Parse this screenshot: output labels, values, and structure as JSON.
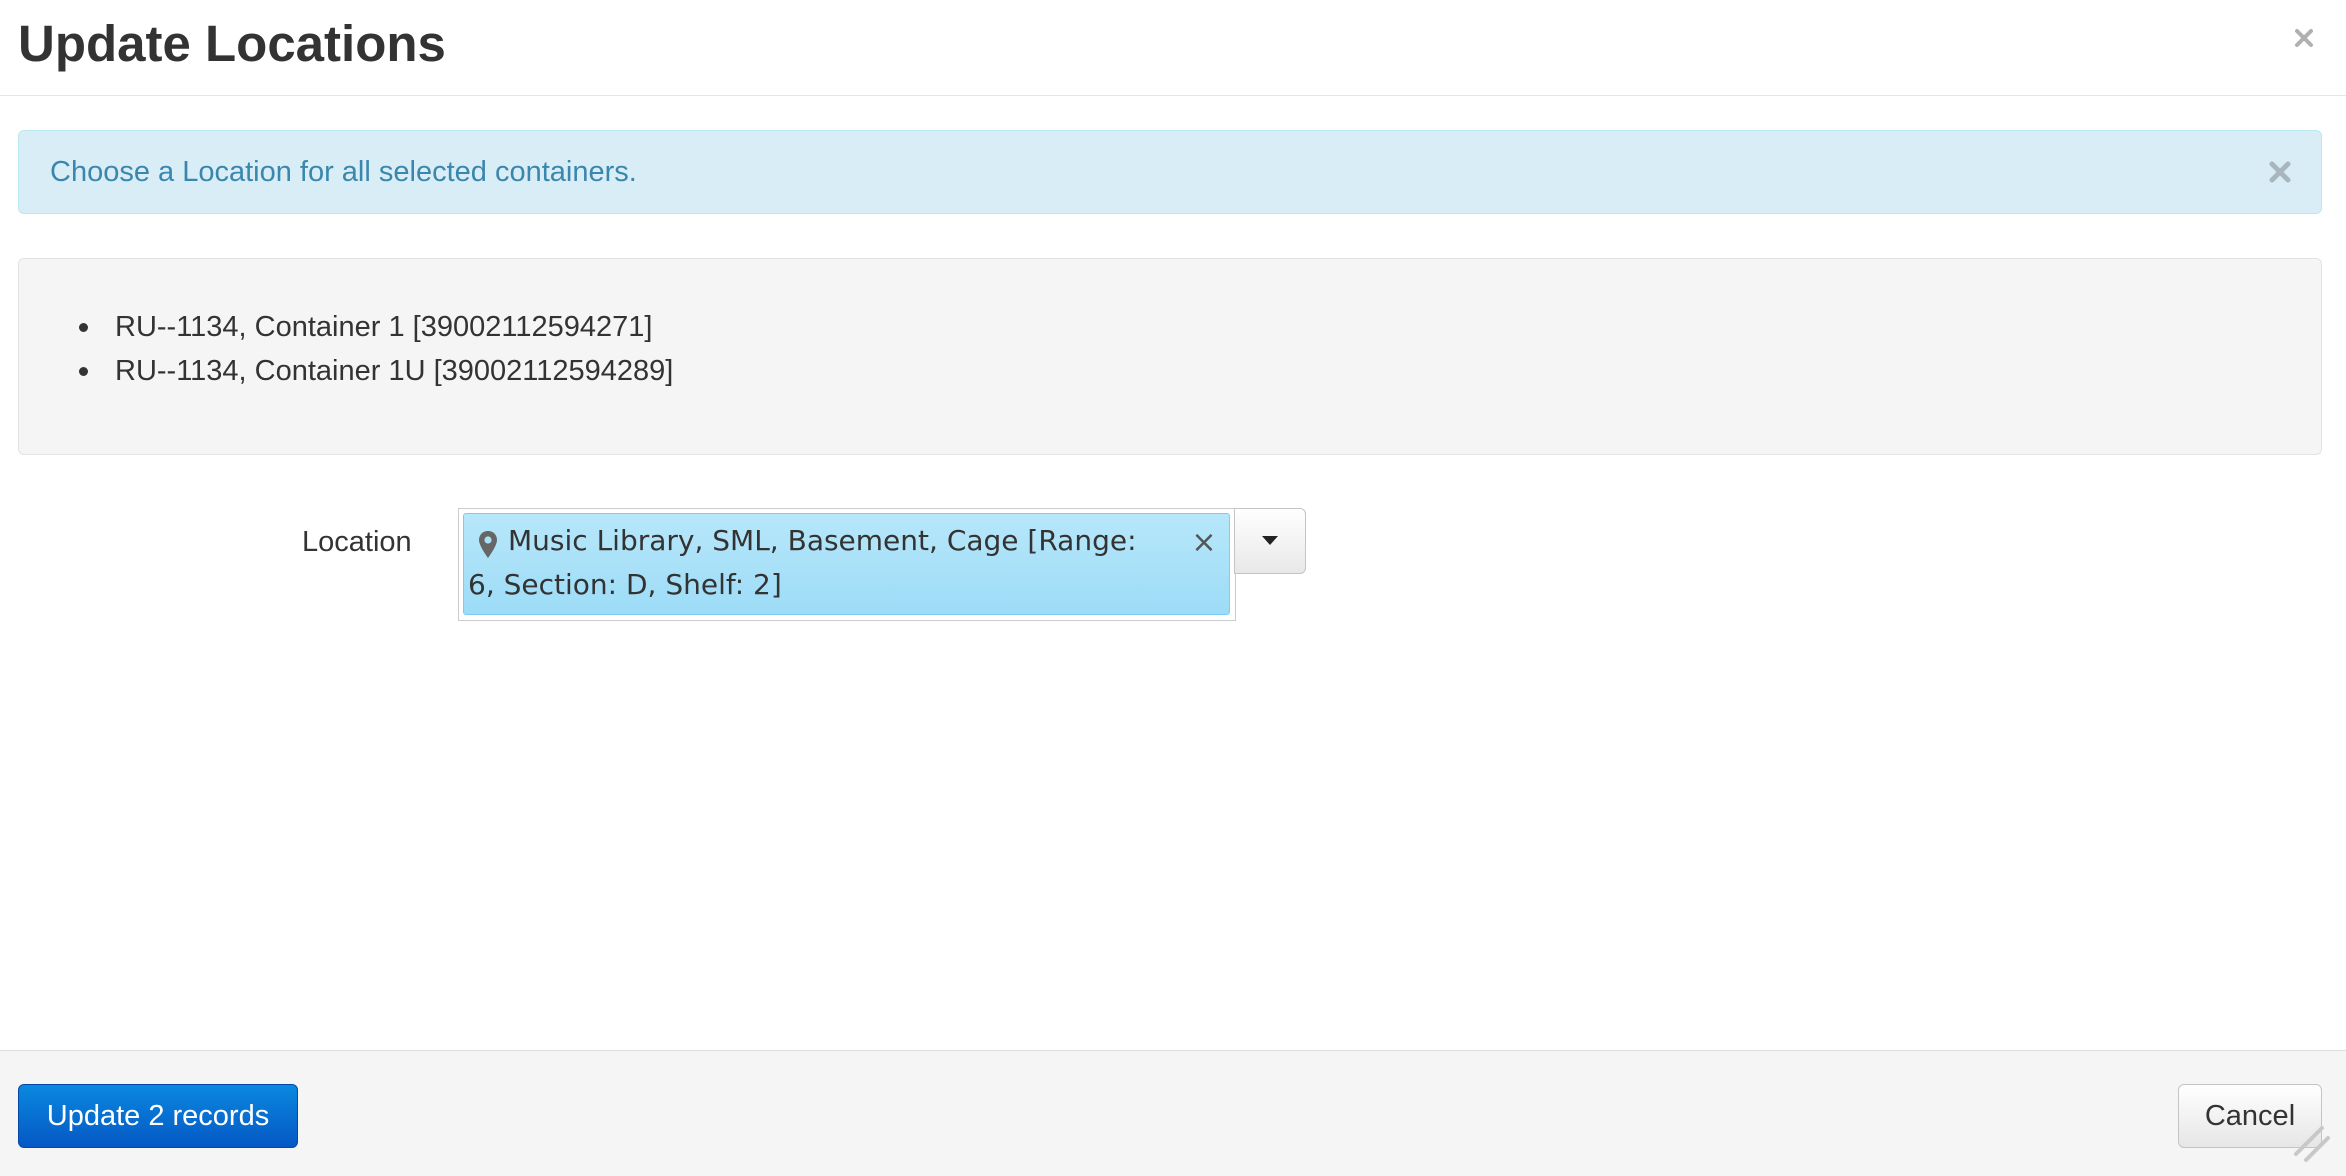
{
  "modal": {
    "title": "Update Locations"
  },
  "alert": {
    "message": "Choose a Location for all selected containers.",
    "type": "info"
  },
  "records": [
    "RU--1134, Container 1 [39002112594271]",
    "RU--1134, Container 1U [39002112594289]"
  ],
  "form": {
    "location_label": "Location",
    "selected_location": "Music Library, SML, Basement, Cage [Range: 6, Section: D, Shelf: 2]",
    "token_icon": "map-marker-icon",
    "remove_symbol": "×"
  },
  "footer": {
    "primary_label": "Update 2 records",
    "cancel_label": "Cancel"
  },
  "colors": {
    "alert_background": "#d9edf7",
    "alert_text": "#3a87ad",
    "token_background": "#9ddcf7",
    "primary_button": "#0558c4"
  }
}
